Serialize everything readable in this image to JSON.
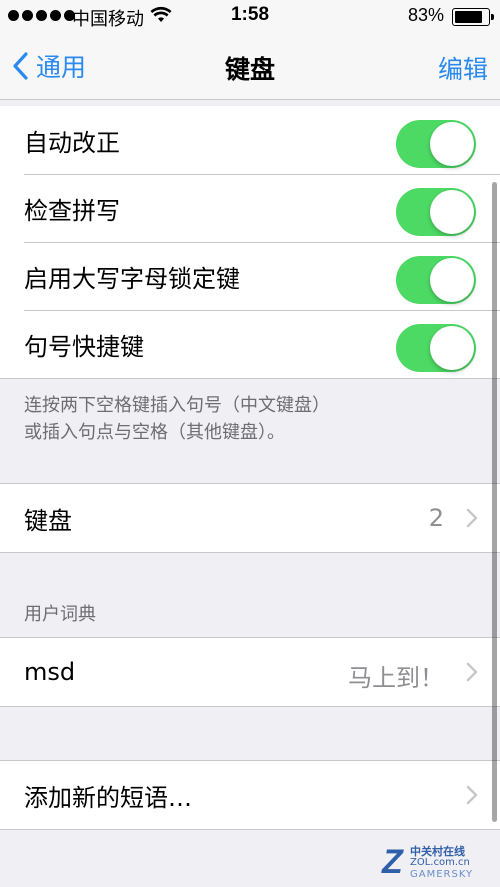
{
  "status_bar": {
    "carrier": "中国移动",
    "time": "1:58",
    "battery_percent": "83%",
    "battery_level": 0.83,
    "icons": [
      "signal-dots-icon",
      "wifi-icon",
      "battery-icon"
    ]
  },
  "nav": {
    "back_label": "通用",
    "title": "键盘",
    "edit_label": "编辑",
    "accent_color": "#2a8aef"
  },
  "toggles": [
    {
      "label": "自动改正",
      "on": true
    },
    {
      "label": "检查拼写",
      "on": true
    },
    {
      "label": "启用大写字母锁定键",
      "on": true
    },
    {
      "label": "句号快捷键",
      "on": true
    }
  ],
  "toggle_on_color": "#4cd964",
  "footer_note_line1": "连按两下空格键插入句号（中文键盘）",
  "footer_note_line2": "或插入句点与空格（其他键盘）。",
  "keyboards_row": {
    "label": "键盘",
    "value": "2"
  },
  "user_dictionary": {
    "header": "用户词典",
    "entries": [
      {
        "shortcut": "msd",
        "phrase": "马上到！"
      }
    ]
  },
  "add_phrase_label": "添加新的短语…",
  "watermark": {
    "logo": "Z",
    "line1": "中关村在线",
    "line2": "ZOL.com.cn",
    "line3": "GAMERSKY"
  }
}
